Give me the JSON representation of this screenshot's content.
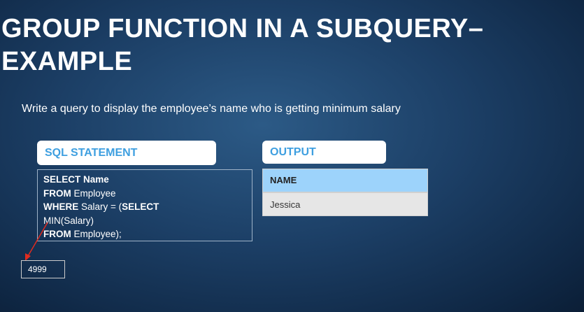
{
  "slide": {
    "title_line1": "GROUP FUNCTION IN A SUBQUERY–",
    "title_line2": "EXAMPLE",
    "subtitle": "Write a query to display the employee’s name who is getting minimum salary",
    "sql_header": "SQL STATEMENT",
    "output_header": "OUTPUT",
    "sql": {
      "l1_kw": "SELECT Name",
      "l2_kw": "FROM",
      "l2": " Employee",
      "l3_kw": "WHERE",
      "l3": " Salary = (",
      "l3_kw2": "SELECT",
      "l4": "MIN(Salary)",
      "l5_kw": "FROM",
      "l5": " Employee);"
    },
    "table": {
      "header": "NAME",
      "rows": [
        "Jessica"
      ]
    },
    "annotation_value": "4999",
    "colors": {
      "header_text": "#3e9fe0",
      "table_header": "#9dd3fb",
      "arrow": "#e02b1f"
    }
  }
}
